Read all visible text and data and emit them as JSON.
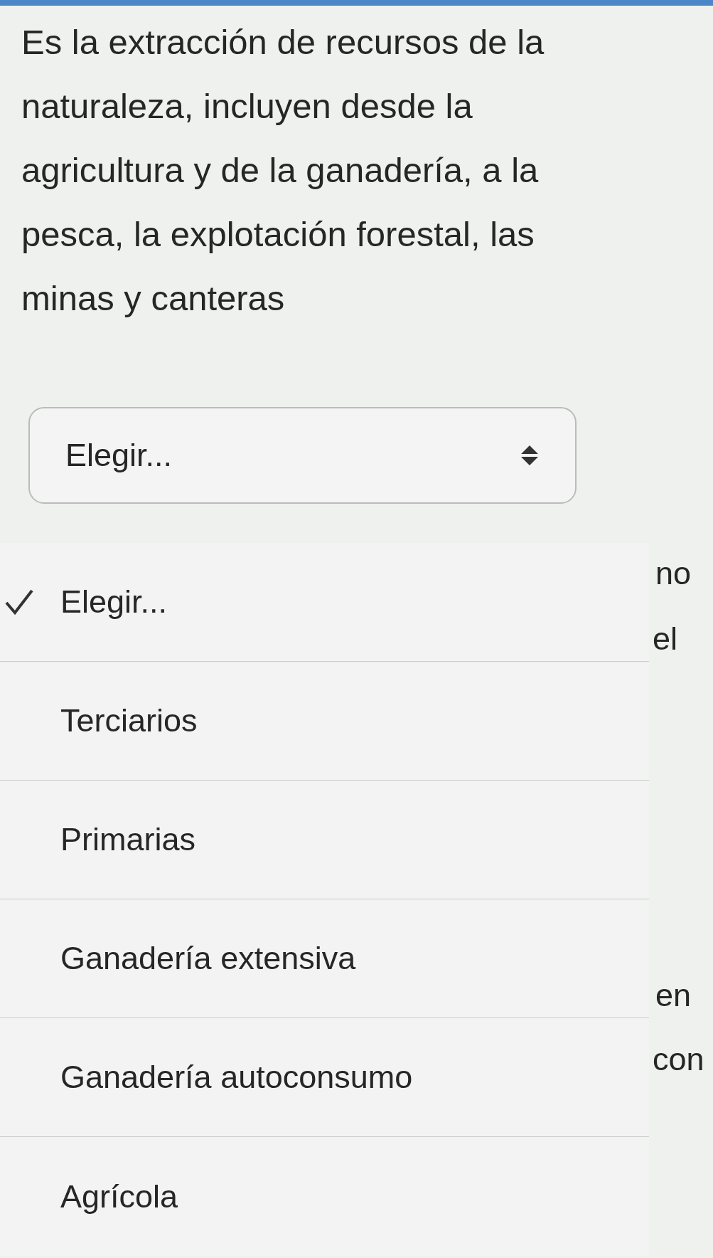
{
  "paragraph": "Es la extracción de recursos de la naturaleza, incluyen desde la agricultura y de la ganadería, a la pesca, la explotación forestal, las minas y canteras",
  "select": {
    "value": "Elegir..."
  },
  "background_fragments": [
    {
      "text": "no"
    },
    {
      "text": "el"
    },
    {
      "text": "en"
    },
    {
      "text": "con"
    }
  ],
  "menu": {
    "options": [
      {
        "label": "Elegir...",
        "selected": true
      },
      {
        "label": "Terciarios",
        "selected": false
      },
      {
        "label": "Primarias",
        "selected": false
      },
      {
        "label": "Ganadería extensiva",
        "selected": false
      },
      {
        "label": "Ganadería autoconsumo",
        "selected": false
      },
      {
        "label": "Agrícola",
        "selected": false
      }
    ]
  }
}
